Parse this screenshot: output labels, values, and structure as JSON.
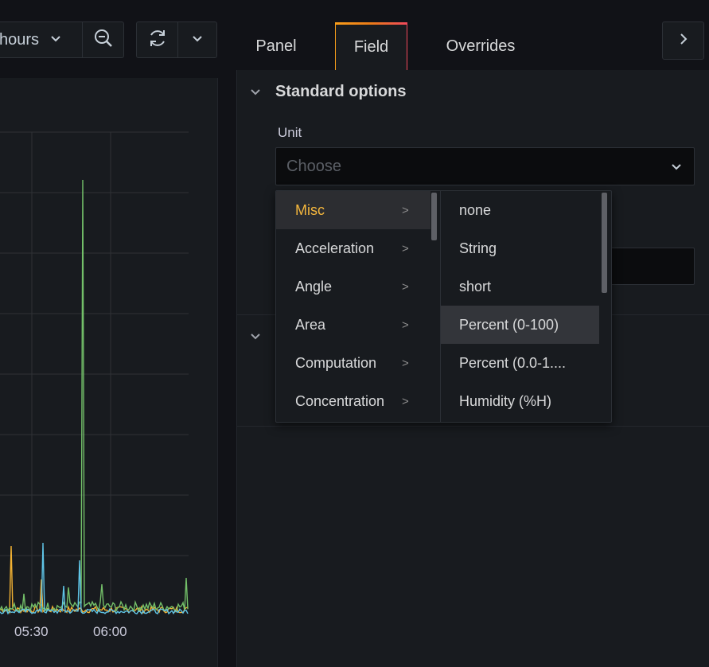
{
  "toolbar": {
    "time_range_label": "hours",
    "icons": [
      "chevron-down-icon",
      "zoom-out-icon",
      "refresh-icon",
      "chevron-down-icon"
    ]
  },
  "graph": {
    "x_ticks": [
      "05:30",
      "06:00"
    ],
    "colors": {
      "green": "#73bf69",
      "yellow": "#f2b233",
      "cyan": "#5fc4e6",
      "grid": "#2f3136"
    }
  },
  "tabs": [
    {
      "label": "Panel"
    },
    {
      "label": "Field",
      "active": true
    },
    {
      "label": "Overrides"
    }
  ],
  "editor": {
    "section_title": "Standard options",
    "unit_label": "Unit",
    "unit_placeholder": "Choose"
  },
  "cascader": {
    "categories": [
      {
        "label": "Misc",
        "active": true
      },
      {
        "label": "Acceleration"
      },
      {
        "label": "Angle"
      },
      {
        "label": "Area"
      },
      {
        "label": "Computation"
      },
      {
        "label": "Concentration"
      }
    ],
    "arrow": ">",
    "options": [
      {
        "label": "none"
      },
      {
        "label": "String"
      },
      {
        "label": "short"
      },
      {
        "label": "Percent (0-100)",
        "active": true
      },
      {
        "label": "Percent (0.0-1...."
      },
      {
        "label": "Humidity (%H)"
      }
    ]
  }
}
